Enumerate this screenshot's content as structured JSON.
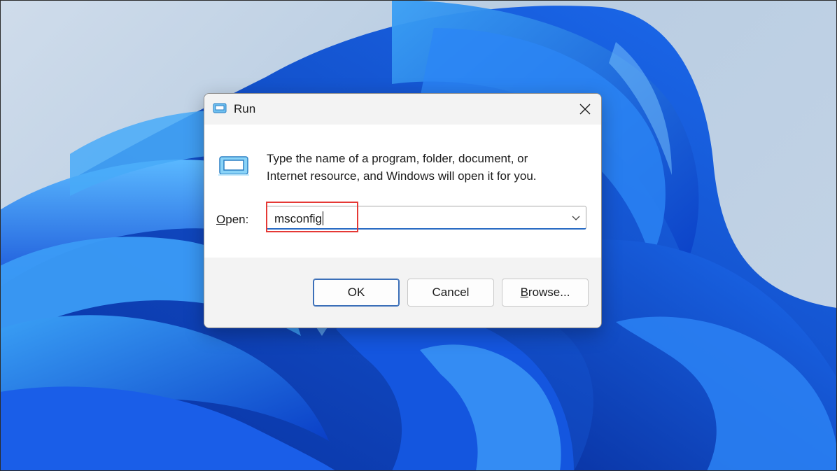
{
  "dialog": {
    "title": "Run",
    "description_line1": "Type the name of a program, folder, document, or",
    "description_line2": "Internet resource, and Windows will open it for you.",
    "open_label_accel": "O",
    "open_label_rest": "pen:",
    "open_value": "msconfig",
    "buttons": {
      "ok": "OK",
      "cancel": "Cancel",
      "browse_accel": "B",
      "browse_rest": "rowse..."
    }
  },
  "icons": {
    "title": "run-app-icon",
    "content": "run-app-icon",
    "close": "close-icon",
    "dropdown": "chevron-down-icon"
  },
  "colors": {
    "highlight": "#e53935",
    "accent": "#2a6cc4",
    "wallpaper_blue": "#1a5ee8"
  }
}
